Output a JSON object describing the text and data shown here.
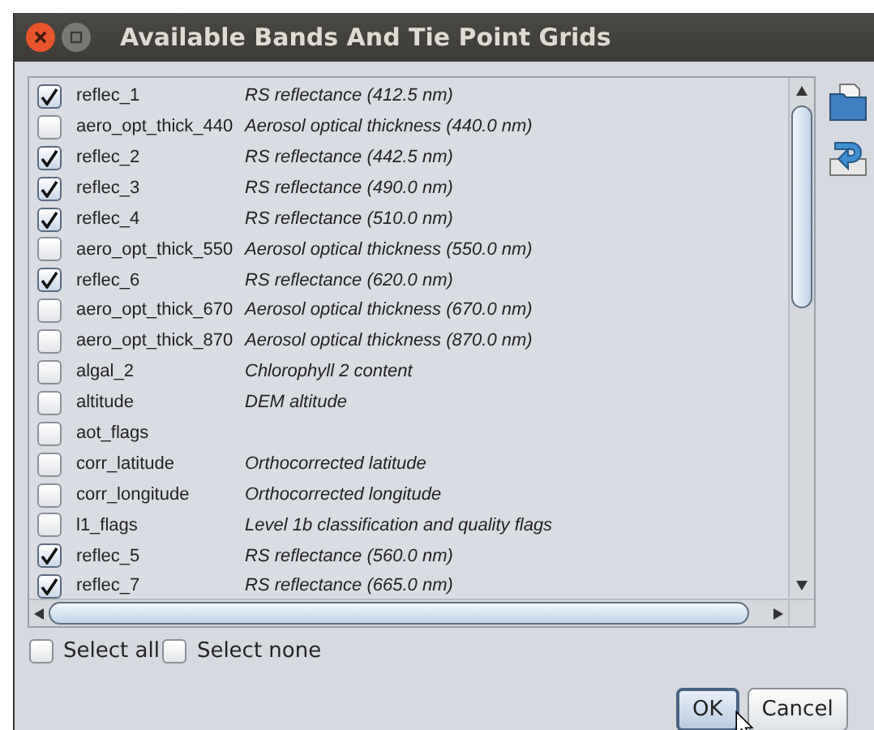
{
  "window": {
    "title": "Available Bands And Tie Point Grids"
  },
  "bands": [
    {
      "name": "reflec_1",
      "description": "RS reflectance (412.5 nm)",
      "checked": true
    },
    {
      "name": "aero_opt_thick_440",
      "description": "Aerosol optical thickness (440.0 nm)",
      "checked": false
    },
    {
      "name": "reflec_2",
      "description": "RS reflectance (442.5 nm)",
      "checked": true
    },
    {
      "name": "reflec_3",
      "description": "RS reflectance (490.0 nm)",
      "checked": true
    },
    {
      "name": "reflec_4",
      "description": "RS reflectance (510.0 nm)",
      "checked": true
    },
    {
      "name": "aero_opt_thick_550",
      "description": "Aerosol optical thickness (550.0 nm)",
      "checked": false
    },
    {
      "name": "reflec_6",
      "description": "RS reflectance (620.0 nm)",
      "checked": true
    },
    {
      "name": "aero_opt_thick_670",
      "description": "Aerosol optical thickness (670.0 nm)",
      "checked": false
    },
    {
      "name": "aero_opt_thick_870",
      "description": "Aerosol optical thickness (870.0 nm)",
      "checked": false
    },
    {
      "name": "algal_2",
      "description": "Chlorophyll 2 content",
      "checked": false
    },
    {
      "name": "altitude",
      "description": "DEM altitude",
      "checked": false
    },
    {
      "name": "aot_flags",
      "checked": false
    },
    {
      "name": "corr_latitude",
      "description": "Orthocorrected latitude",
      "checked": false
    },
    {
      "name": "corr_longitude",
      "description": "Orthocorrected longitude",
      "checked": false
    },
    {
      "name": "l1_flags",
      "description": "Level 1b classification and quality flags",
      "checked": false
    },
    {
      "name": "reflec_5",
      "description": "RS reflectance (560.0 nm)",
      "checked": true
    },
    {
      "name": "reflec_7",
      "description": "RS reflectance (665.0 nm)",
      "checked": true
    }
  ],
  "selectors": [
    {
      "label": "Select all",
      "checked": false
    },
    {
      "label": "Select none",
      "checked": false
    }
  ],
  "buttons": [
    {
      "label": "OK",
      "default": true
    },
    {
      "label": "Cancel",
      "default": false
    }
  ]
}
